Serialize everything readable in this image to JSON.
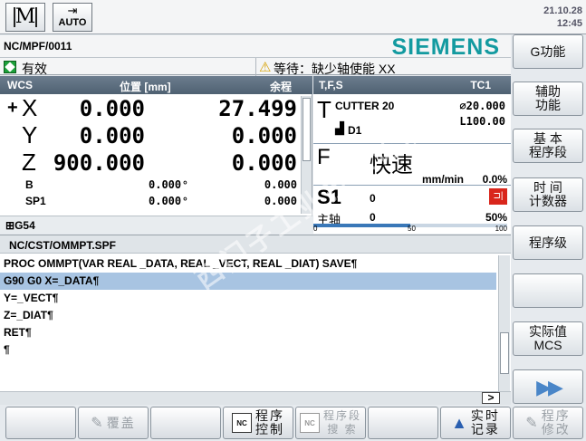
{
  "topbar": {
    "mode_icon": "M",
    "auto_label": "AUTO",
    "date": "21.10.28",
    "time": "12:45"
  },
  "header": {
    "path": "NC/MPF/0011",
    "brand": "SIEMENS",
    "status": "有效",
    "alarm": "等待：缺少轴使能 XX"
  },
  "wcs": {
    "title": "WCS",
    "pos_header": "位置 [mm]",
    "rem_header": "余程",
    "axes": [
      {
        "prefix": "+",
        "name": "X",
        "pos": "0.000",
        "rem": "27.499"
      },
      {
        "prefix": "",
        "name": "Y",
        "pos": "0.000",
        "rem": "0.000"
      },
      {
        "prefix": "",
        "name": "Z",
        "pos": "900.000",
        "rem": "0.000"
      }
    ],
    "sub_axes": [
      {
        "name": "B",
        "pos": "0.000",
        "unit": "°",
        "rem": "0.000"
      },
      {
        "name": "SP1",
        "pos": "0.000",
        "unit": "°",
        "rem": "0.000"
      }
    ],
    "frame": "G54"
  },
  "tfs": {
    "title": "T,F,S",
    "tc": "TC1",
    "tool": "CUTTER 20",
    "diam": "⌀20.000",
    "length": "L100.00",
    "d": "D1",
    "feed_label": "F",
    "feed_value": "快速",
    "feed_unit": "mm/min",
    "feed_pct": "0.0%",
    "spindle": "S1",
    "spindle_value": "0",
    "spindle_sub": "主轴",
    "spindle_sub_value": "0",
    "spindle_pct": "50%",
    "scale": [
      "0",
      "50",
      "100"
    ],
    "override_level": 0.5
  },
  "program": {
    "path": "NC/CST/OMMPT.SPF",
    "lines": [
      "PROC OMMPT(VAR REAL _DATA, REAL _VECT, REAL _DIAT) SAVE¶",
      "G90 G0 X=_DATA¶",
      "Y=_VECT¶",
      "Z=_DIAT¶",
      "RET¶",
      "¶"
    ],
    "selected_line": 1
  },
  "right_softkeys": [
    "G功能",
    "辅助\n功能",
    "基 本\n程序段",
    "时 间\n计数器",
    "程序级",
    "",
    "实际值\nMCS",
    ""
  ],
  "bottom_softkeys": {
    "k1": "",
    "k2": "覆盖",
    "k3": "",
    "k4": "程序\n控制",
    "k5": "程序段\n搜 索",
    "k6": "",
    "k7": "实时\n记录",
    "k8": "程序\n修改"
  },
  "scroll_arrow": ">",
  "watermark": "西门子工业技术论坛"
}
